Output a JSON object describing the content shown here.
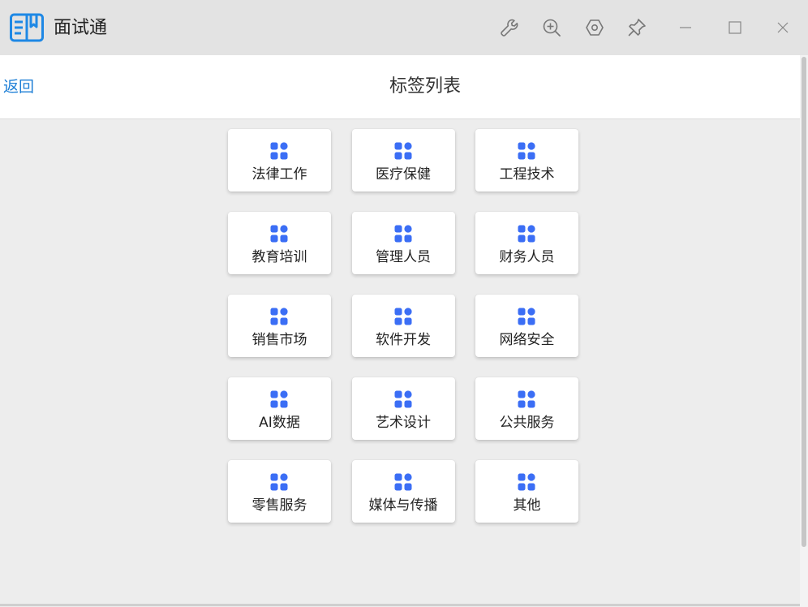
{
  "app": {
    "title": "面试通",
    "brand_color": "#1e88e5",
    "toolbar_icons": [
      "wrench-icon",
      "zoom-in-icon",
      "settings-hex-icon",
      "pin-icon"
    ],
    "window_controls": [
      "minimize-icon",
      "maximize-icon",
      "close-icon"
    ]
  },
  "header": {
    "back_label": "返回",
    "title": "标签列表"
  },
  "tags": [
    {
      "label": "法律工作"
    },
    {
      "label": "医疗保健"
    },
    {
      "label": "工程技术"
    },
    {
      "label": "教育培训"
    },
    {
      "label": "管理人员"
    },
    {
      "label": "财务人员"
    },
    {
      "label": "销售市场"
    },
    {
      "label": "软件开发"
    },
    {
      "label": "网络安全"
    },
    {
      "label": "AI数据"
    },
    {
      "label": "艺术设计"
    },
    {
      "label": "公共服务"
    },
    {
      "label": "零售服务"
    },
    {
      "label": "媒体与传播"
    },
    {
      "label": "其他"
    }
  ],
  "colors": {
    "accent": "#1e7fd6",
    "tag_icon": "#3b6ef5",
    "background": "#ededed"
  }
}
